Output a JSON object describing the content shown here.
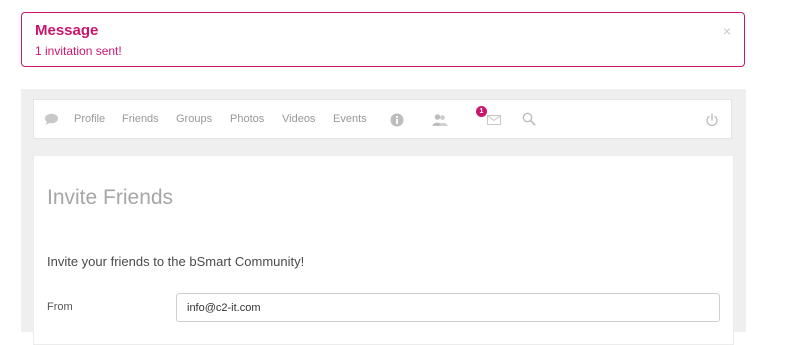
{
  "alert": {
    "title": "Message",
    "text": "1 invitation sent!",
    "close_glyph": "×",
    "color": "#c9176e"
  },
  "nav": {
    "icons": {
      "chat": "chat-bubble-icon",
      "info": "info-icon",
      "friend_requests": "friend-requests-icon",
      "messages": "envelope-icon",
      "search": "search-icon",
      "logout": "power-icon"
    },
    "links": [
      "Profile",
      "Friends",
      "Groups",
      "Photos",
      "Videos",
      "Events"
    ],
    "friend_request_count": "1"
  },
  "main": {
    "title": "Invite Friends",
    "subtitle": "Invite your friends to the bSmart Community!",
    "from_label": "From",
    "from_value": "info@c2-it.com"
  }
}
